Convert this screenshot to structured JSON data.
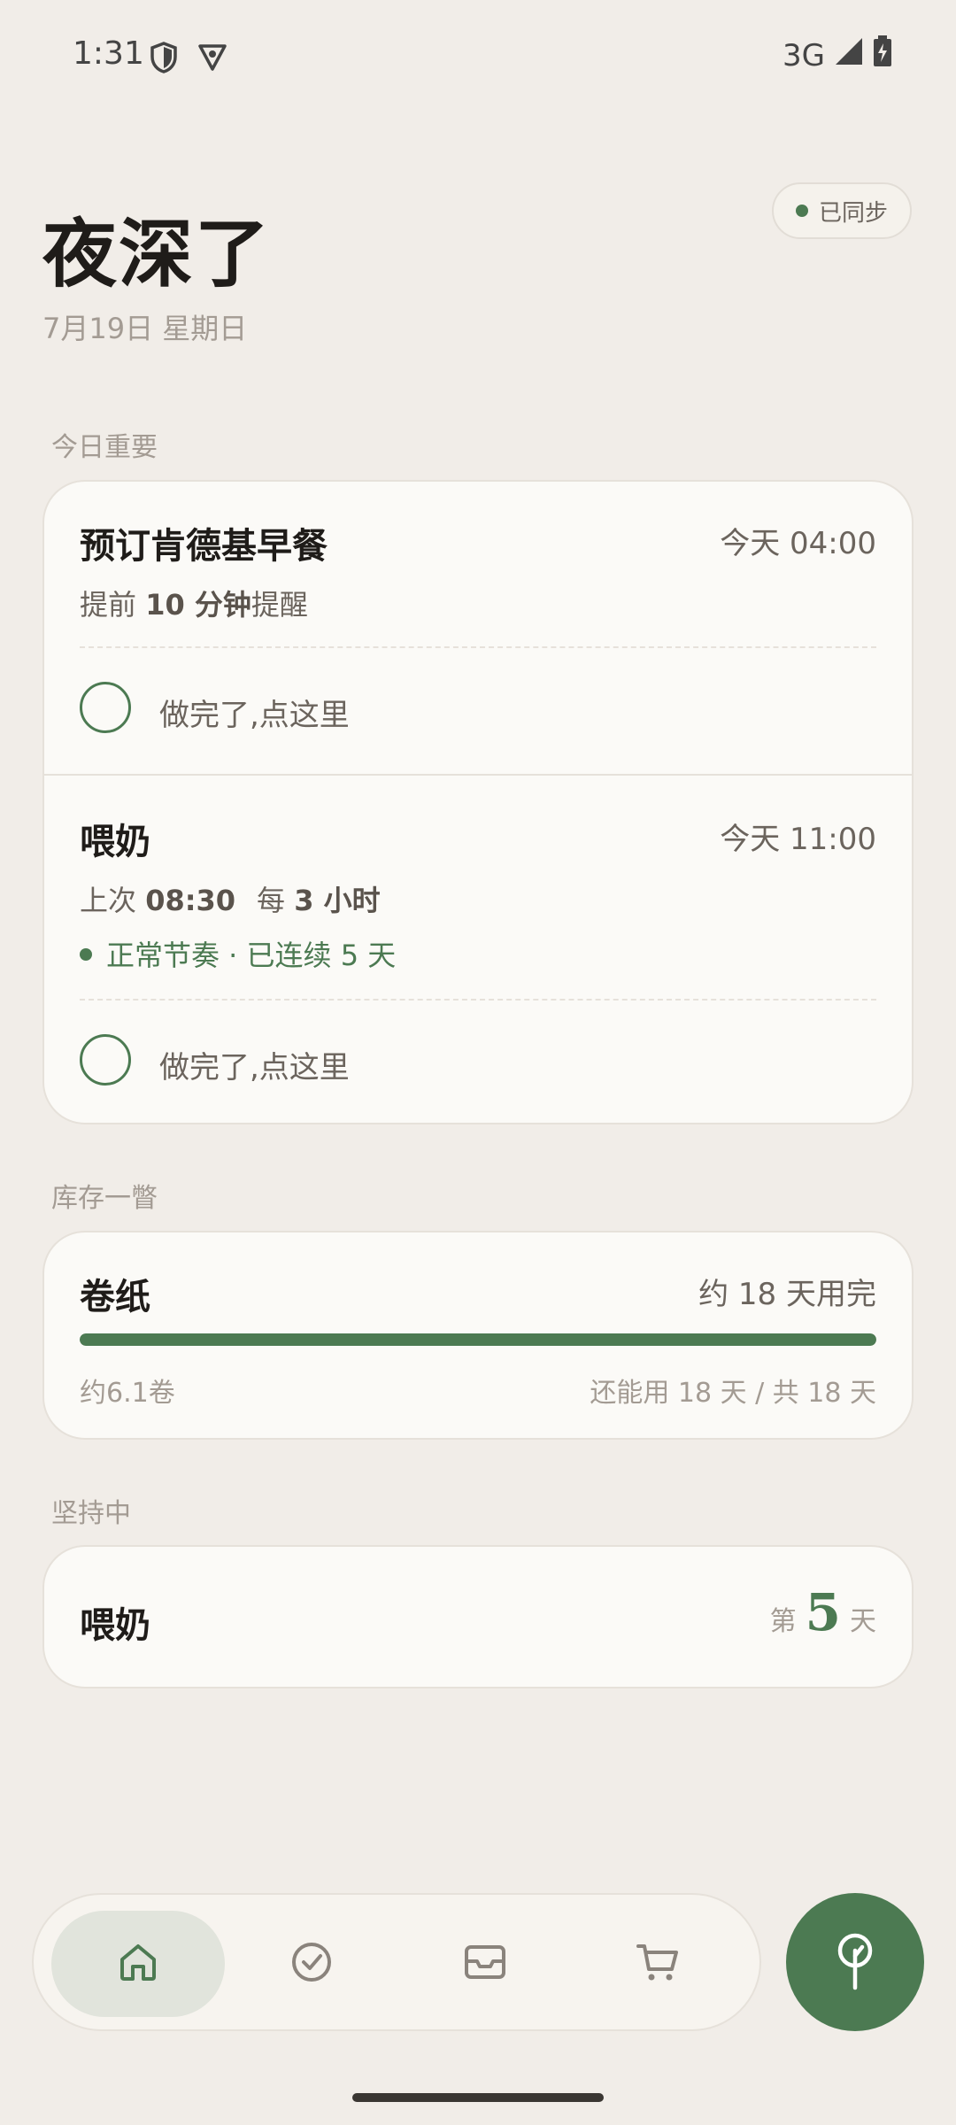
{
  "status_bar": {
    "time": "1:31",
    "network": "3G"
  },
  "header": {
    "title": "夜深了",
    "date": "7月19日 星期日",
    "sync_label": "已同步"
  },
  "sections": {
    "today_label": "今日重要",
    "inventory_label": "库存一瞥",
    "habits_label": "坚持中"
  },
  "tasks": [
    {
      "title": "预订肯德基早餐",
      "time": "今天 04:00",
      "sub_prefix": "提前 ",
      "sub_bold": "10 分钟",
      "sub_suffix": "提醒",
      "done_label": "做完了,点这里"
    },
    {
      "title": "喂奶",
      "time": "今天 11:00",
      "last_prefix": "上次 ",
      "last_value": "08:30",
      "every_prefix": "每 ",
      "every_value": "3 小时",
      "streak": "正常节奏 · 已连续 5 天",
      "done_label": "做完了,点这里"
    }
  ],
  "inventory": {
    "name": "卷纸",
    "estimate": "约 18 天用完",
    "remaining_fraction": 1.0,
    "amount": "约6.1卷",
    "detail": "还能用 18 天 / 共 18 天"
  },
  "habit": {
    "name": "喂奶",
    "prefix": "第",
    "days": "5",
    "suffix": "天"
  },
  "nav": {
    "items": [
      "home-icon",
      "check-circle-icon",
      "inbox-icon",
      "cart-icon"
    ],
    "active": "home-icon",
    "fab_icon": "tree-icon"
  },
  "colors": {
    "accent": "#4c7a52",
    "background": "#f1ede8",
    "card": "#fbfaf7"
  }
}
